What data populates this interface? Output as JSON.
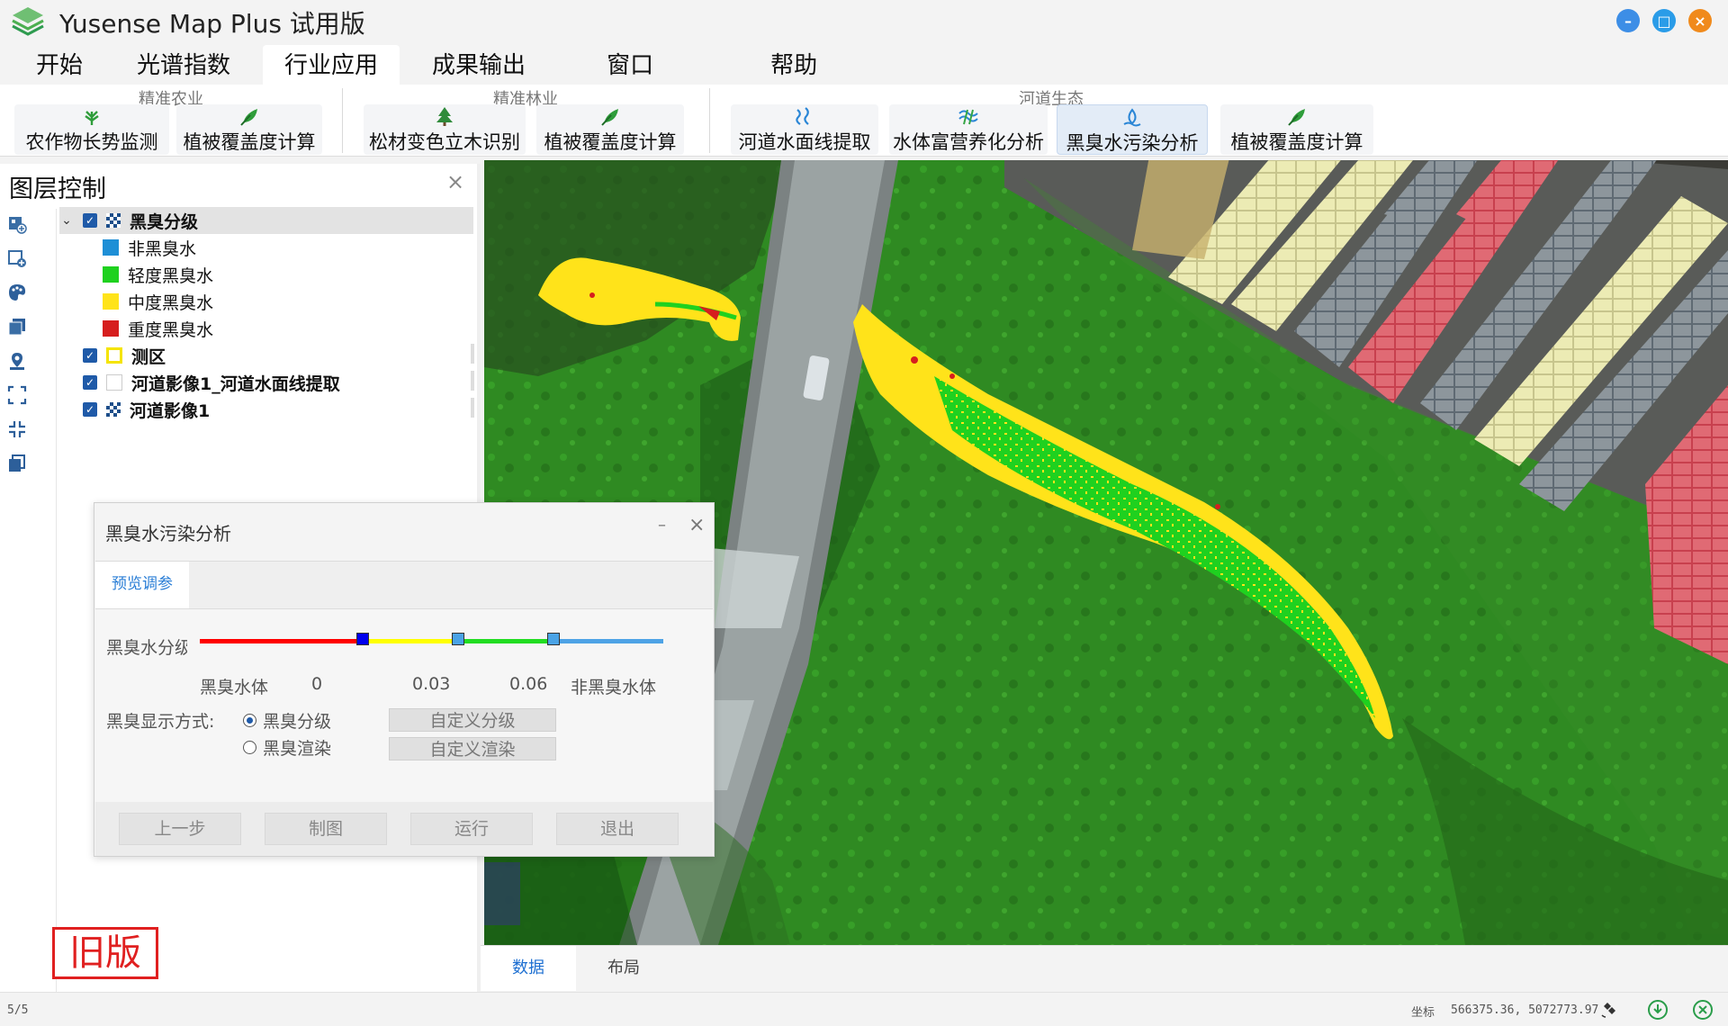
{
  "app": {
    "title": "Yusense Map Plus 试用版"
  },
  "menu": {
    "tabs": [
      "开始",
      "光谱指数",
      "行业应用",
      "成果输出",
      "窗口",
      "帮助"
    ],
    "active": "行业应用"
  },
  "ribbon": {
    "groups": [
      {
        "title": "精准农业",
        "buttons": [
          "农作物长势监测",
          "植被覆盖度计算"
        ]
      },
      {
        "title": "精准林业",
        "buttons": [
          "松材变色立木识别",
          "植被覆盖度计算"
        ]
      },
      {
        "title": "河道生态",
        "buttons": [
          "河道水面线提取",
          "水体富营养化分析",
          "黑臭水污染分析",
          "植被覆盖度计算"
        ]
      }
    ],
    "active_button": "黑臭水污染分析"
  },
  "layer_panel": {
    "title": "图层控制",
    "close": "×",
    "layers": [
      {
        "label": "黑臭分级",
        "checked": true,
        "expanded": true,
        "legend": [
          {
            "label": "非黑臭水",
            "color": "#1e8fd6"
          },
          {
            "label": "轻度黑臭水",
            "color": "#1fd11f"
          },
          {
            "label": "中度黑臭水",
            "color": "#ffe31a"
          },
          {
            "label": "重度黑臭水",
            "color": "#d61e1e"
          }
        ]
      },
      {
        "label": "测区",
        "checked": true
      },
      {
        "label": "河道影像1_河道水面线提取",
        "checked": true
      },
      {
        "label": "河道影像1",
        "checked": true
      }
    ],
    "tool_icons": [
      "add-raster-icon",
      "add-vector-icon",
      "palette-icon",
      "layers-icon",
      "locate-icon",
      "zoom-extent-icon",
      "zoom-in-icon",
      "copy-icon"
    ]
  },
  "old_version_label": "旧版",
  "dialog": {
    "title": "黑臭水污染分析",
    "minimize": "–",
    "close": "×",
    "tab": "预览调参",
    "grade_label": "黑臭水分级",
    "thresholds": {
      "low_label": "黑臭水体",
      "t1": "0",
      "t2": "0.03",
      "t3": "0.06",
      "high_label": "非黑臭水体"
    },
    "display_label": "黑臭显示方式:",
    "options": [
      {
        "label": "黑臭分级",
        "checked": true
      },
      {
        "label": "黑臭渲染",
        "checked": false
      }
    ],
    "custom_grade_button": "自定义分级",
    "custom_render_button": "自定义渲染",
    "footer_buttons": [
      "上一步",
      "制图",
      "运行",
      "退出"
    ],
    "colors": {
      "red": "#ff0000",
      "yellow": "#ffff00",
      "green": "#22dd22",
      "blue": "#4ea3e6",
      "handle_dark": "#0000ee",
      "handle_light": "#4aa3e6"
    }
  },
  "bottom_tabs": {
    "tabs": [
      "数据",
      "布局"
    ],
    "active": "数据"
  },
  "status": {
    "page": "5/5",
    "coord_label": "坐标",
    "coord_value": "566375.36, 5072773.97"
  }
}
